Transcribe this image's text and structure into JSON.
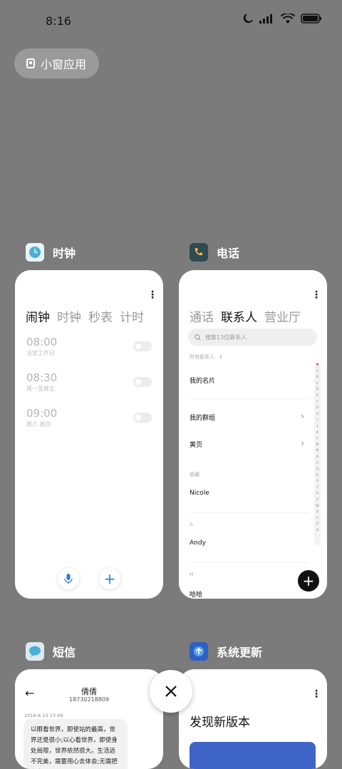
{
  "status_bar": {
    "time": "8:16"
  },
  "small_window": {
    "label": "小窗应用"
  },
  "apps": {
    "clock": {
      "name": "时钟",
      "tabs": [
        "闹钟",
        "时钟",
        "秒表",
        "计时"
      ],
      "alarms": [
        {
          "time": "08:00",
          "repeat": "法定工作日"
        },
        {
          "time": "08:30",
          "repeat": "周一至周五"
        },
        {
          "time": "09:00",
          "repeat": "周六 周日"
        }
      ]
    },
    "phone": {
      "name": "电话",
      "tabs": [
        "通话",
        "联系人",
        "营业厅"
      ],
      "search_placeholder": "搜索13位联系人",
      "filter": "所有联系人",
      "my_card": "我的名片",
      "my_groups": "我的群组",
      "yellow_pages": "黄页",
      "favorites_label": "收藏",
      "favorite_contact": "Nicole",
      "section_a": "A",
      "contact_a": "Andy",
      "section_h": "H",
      "contact_h": "哈哈",
      "alphabet": [
        "♥",
        "A",
        "B",
        "C",
        "D",
        "E",
        "F",
        "G",
        "H",
        "I",
        "J",
        "K",
        "L",
        "M",
        "N",
        "O",
        "P",
        "Q",
        "R",
        "S",
        "T",
        "U",
        "V",
        "W",
        "X",
        "Y",
        "Z",
        "#"
      ]
    },
    "sms": {
      "name": "短信",
      "contact_name": "倩倩",
      "contact_number": "18730218809",
      "date": "2016-6-13 13:49",
      "message": "以眼看世界，即使站的最高，世界还是很小;以心看世界，即使身处局限，世界依然很大。生活远不完美，需要用心去体会;无需把有太"
    },
    "update": {
      "name": "系统更新",
      "headline": "发现新版本"
    }
  },
  "colors": {
    "background": "#7b7b7b",
    "accent": "#2a7be4",
    "update_banner": "#3f64c8"
  }
}
